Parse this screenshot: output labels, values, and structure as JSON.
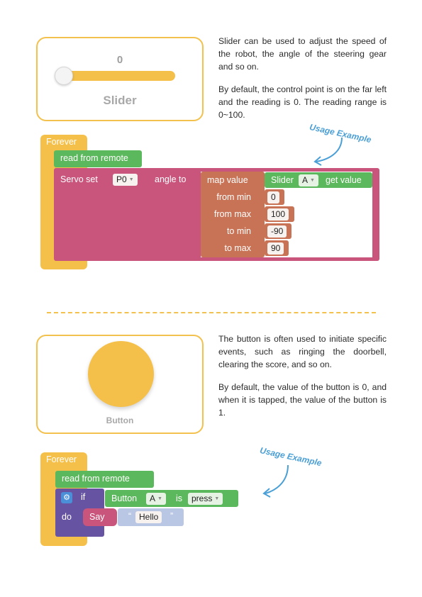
{
  "slider_section": {
    "card": {
      "value": "0",
      "label": "Slider"
    },
    "paragraphs": [
      "Slider can be used to adjust the speed of the robot, the angle of the steering gear and so on.",
      "By default, the control point is on the far left and the reading is 0. The reading range is 0~100."
    ],
    "usage_label": "Usage Example",
    "code": {
      "forever": "Forever",
      "read_remote": "read from remote",
      "servo_set": "Servo set",
      "port": "P0",
      "angle_to": "angle to",
      "map_value": "map value",
      "slider_block": "Slider",
      "slider_id": "A",
      "get_value": "get value",
      "from_min_label": "from min",
      "from_min": "0",
      "from_max_label": "from max",
      "from_max": "100",
      "to_min_label": "to min",
      "to_min": "-90",
      "to_max_label": "to max",
      "to_max": "90"
    }
  },
  "button_section": {
    "card": {
      "label": "Button"
    },
    "paragraphs": [
      "The button is often used to initiate specific events, such as ringing the doorbell, clearing the score, and so on.",
      "By default, the value of the button is 0, and when it is tapped, the value of the button is 1."
    ],
    "usage_label": "Usage Example",
    "code": {
      "forever": "Forever",
      "read_remote": "read from remote",
      "if_kw": "if",
      "button_block": "Button",
      "button_id": "A",
      "is_kw": "is",
      "state": "press",
      "do_kw": "do",
      "say": "Say",
      "quote_open": "“",
      "hello": "Hello",
      "quote_close": "”"
    }
  },
  "colors": {
    "accent": "#f2c14e",
    "knob_fill": "#f5c04a",
    "forever": "#f5c04a",
    "remote": "#5cb85c",
    "servo": "#c9547c",
    "map": "#c87356",
    "if_block": "#6654a3",
    "say_block": "#c9547c",
    "text_block": "#b9c6e4",
    "usage_text": "#4a9fd6"
  },
  "icons": [
    "gear-icon",
    "dropdown-arrow-icon",
    "curved-arrow-icon"
  ]
}
